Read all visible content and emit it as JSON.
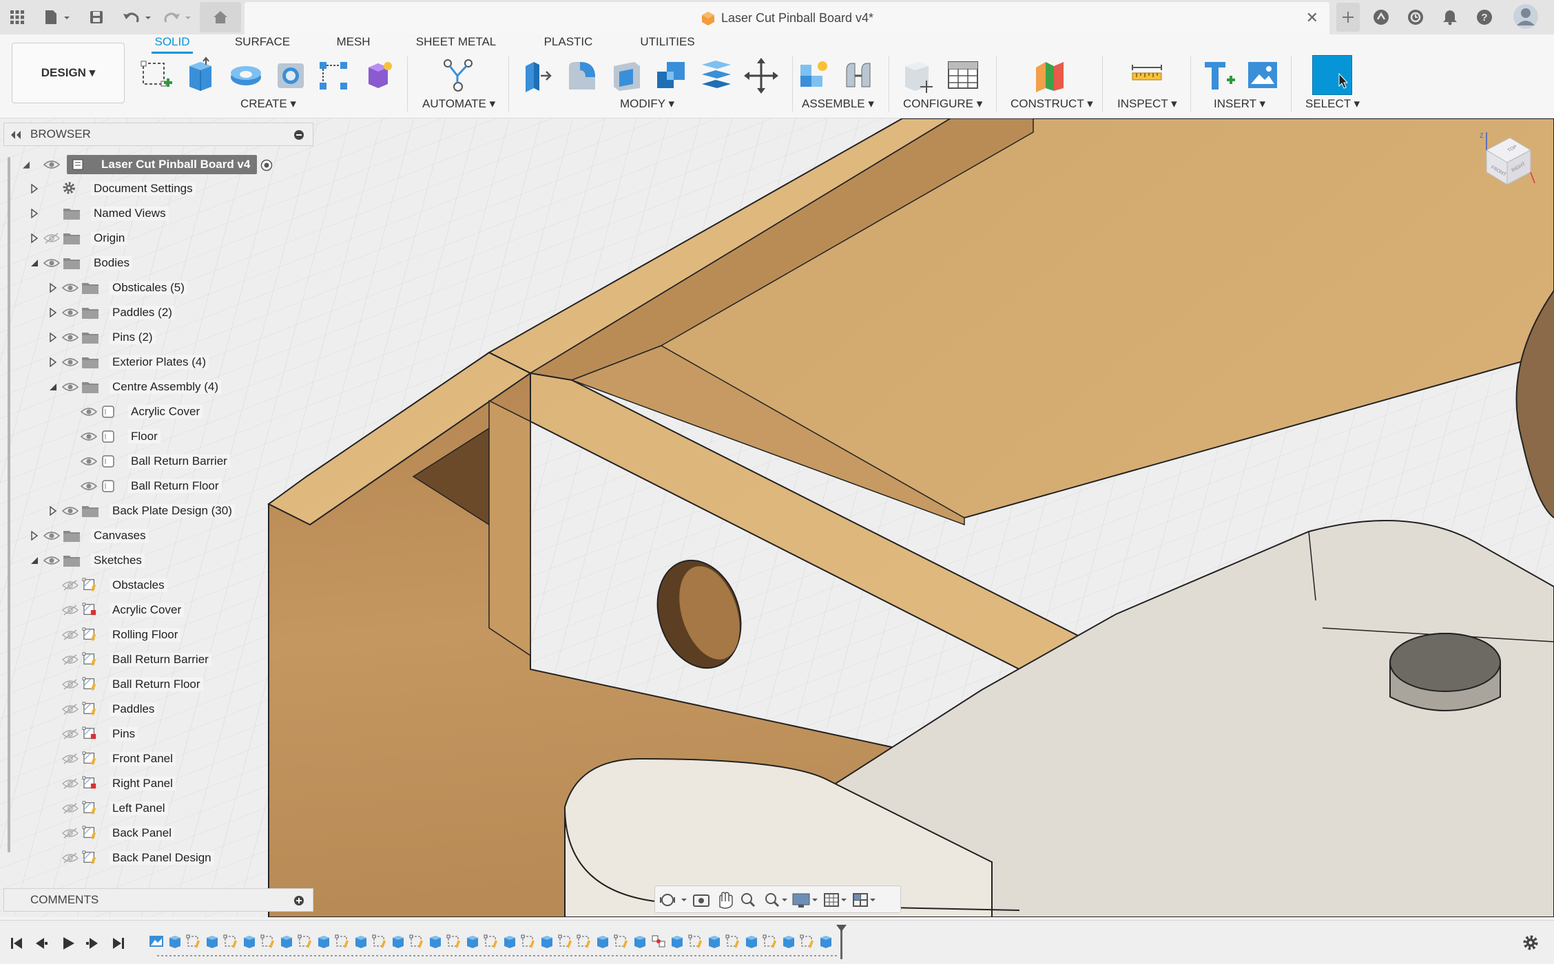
{
  "top_bar": {
    "document_title": "Laser Cut Pinball Board v4*"
  },
  "toolbar": {
    "design_button": "DESIGN ▾",
    "tabs": [
      {
        "label": "SOLID",
        "active": true
      },
      {
        "label": "SURFACE",
        "active": false
      },
      {
        "label": "MESH",
        "active": false
      },
      {
        "label": "SHEET METAL",
        "active": false
      },
      {
        "label": "PLASTIC",
        "active": false
      },
      {
        "label": "UTILITIES",
        "active": false
      }
    ],
    "groups": {
      "create": "CREATE ▾",
      "automate": "AUTOMATE ▾",
      "modify": "MODIFY ▾",
      "assemble": "ASSEMBLE ▾",
      "configure": "CONFIGURE ▾",
      "construct": "CONSTRUCT ▾",
      "inspect": "INSPECT ▾",
      "insert": "INSERT ▾",
      "select": "SELECT ▾"
    },
    "accent_color": "#0696d7"
  },
  "browser": {
    "title": "BROWSER",
    "root": "Laser Cut Pinball Board v4",
    "items": [
      {
        "label": "Document Settings",
        "level": 1,
        "kind": "settings",
        "expander": "closed",
        "eye": "none"
      },
      {
        "label": "Named Views",
        "level": 1,
        "kind": "folder",
        "expander": "closed",
        "eye": "none"
      },
      {
        "label": "Origin",
        "level": 1,
        "kind": "folder",
        "expander": "closed",
        "eye": "hidden"
      },
      {
        "label": "Bodies",
        "level": 1,
        "kind": "folder",
        "expander": "open",
        "eye": "visible"
      },
      {
        "label": "Obsticales (5)",
        "level": 2,
        "kind": "folder",
        "expander": "closed",
        "eye": "visible"
      },
      {
        "label": "Paddles (2)",
        "level": 2,
        "kind": "folder",
        "expander": "closed",
        "eye": "visible"
      },
      {
        "label": "Pins (2)",
        "level": 2,
        "kind": "folder",
        "expander": "closed",
        "eye": "visible"
      },
      {
        "label": "Exterior Plates (4)",
        "level": 2,
        "kind": "folder",
        "expander": "closed",
        "eye": "visible"
      },
      {
        "label": "Centre Assembly (4)",
        "level": 2,
        "kind": "folder",
        "expander": "open",
        "eye": "visible"
      },
      {
        "label": "Acrylic Cover",
        "level": 3,
        "kind": "body",
        "expander": "none",
        "eye": "visible"
      },
      {
        "label": "Floor",
        "level": 3,
        "kind": "body",
        "expander": "none",
        "eye": "visible"
      },
      {
        "label": "Ball Return Barrier",
        "level": 3,
        "kind": "body",
        "expander": "none",
        "eye": "visible"
      },
      {
        "label": "Ball Return Floor",
        "level": 3,
        "kind": "body",
        "expander": "none",
        "eye": "visible"
      },
      {
        "label": "Back Plate Design (30)",
        "level": 2,
        "kind": "folder",
        "expander": "closed",
        "eye": "visible"
      },
      {
        "label": "Canvases",
        "level": 1,
        "kind": "folder",
        "expander": "closed",
        "eye": "visible"
      },
      {
        "label": "Sketches",
        "level": 1,
        "kind": "folder",
        "expander": "open",
        "eye": "visible"
      },
      {
        "label": "Obstacles",
        "level": 2,
        "kind": "sketch",
        "expander": "none",
        "eye": "hidden"
      },
      {
        "label": "Acrylic Cover",
        "level": 2,
        "kind": "sketch-error",
        "expander": "none",
        "eye": "hidden"
      },
      {
        "label": "Rolling Floor",
        "level": 2,
        "kind": "sketch",
        "expander": "none",
        "eye": "hidden"
      },
      {
        "label": "Ball Return Barrier",
        "level": 2,
        "kind": "sketch",
        "expander": "none",
        "eye": "hidden"
      },
      {
        "label": "Ball Return Floor",
        "level": 2,
        "kind": "sketch",
        "expander": "none",
        "eye": "hidden"
      },
      {
        "label": "Paddles",
        "level": 2,
        "kind": "sketch",
        "expander": "none",
        "eye": "hidden"
      },
      {
        "label": "Pins",
        "level": 2,
        "kind": "sketch-error",
        "expander": "none",
        "eye": "hidden"
      },
      {
        "label": "Front Panel",
        "level": 2,
        "kind": "sketch",
        "expander": "none",
        "eye": "hidden"
      },
      {
        "label": "Right Panel",
        "level": 2,
        "kind": "sketch-error",
        "expander": "none",
        "eye": "hidden"
      },
      {
        "label": "Left Panel",
        "level": 2,
        "kind": "sketch",
        "expander": "none",
        "eye": "hidden"
      },
      {
        "label": "Back Panel",
        "level": 2,
        "kind": "sketch",
        "expander": "none",
        "eye": "hidden"
      },
      {
        "label": "Back Panel Design",
        "level": 2,
        "kind": "sketch",
        "expander": "none",
        "eye": "hidden"
      }
    ]
  },
  "comments": {
    "title": "COMMENTS"
  },
  "viewcube": {
    "faces": [
      "TOP",
      "FRONT",
      "RIGHT"
    ],
    "axis_label": "Z"
  },
  "timeline": {
    "feature_icons": [
      "sketch",
      "extrude",
      "sketch",
      "extrude",
      "sketch",
      "extrude",
      "sketch",
      "extrude",
      "sketch",
      "extrude",
      "sketch",
      "extrude",
      "sketch",
      "extrude",
      "sketch",
      "extrude",
      "sketch",
      "extrude",
      "sketch",
      "extrude",
      "sketch",
      "extrude",
      "sketch",
      "sketch",
      "extrude",
      "sketch",
      "extrude",
      "joint",
      "extrude",
      "sketch",
      "extrude",
      "sketch",
      "extrude",
      "sketch",
      "extrude",
      "sketch",
      "extrude"
    ]
  }
}
